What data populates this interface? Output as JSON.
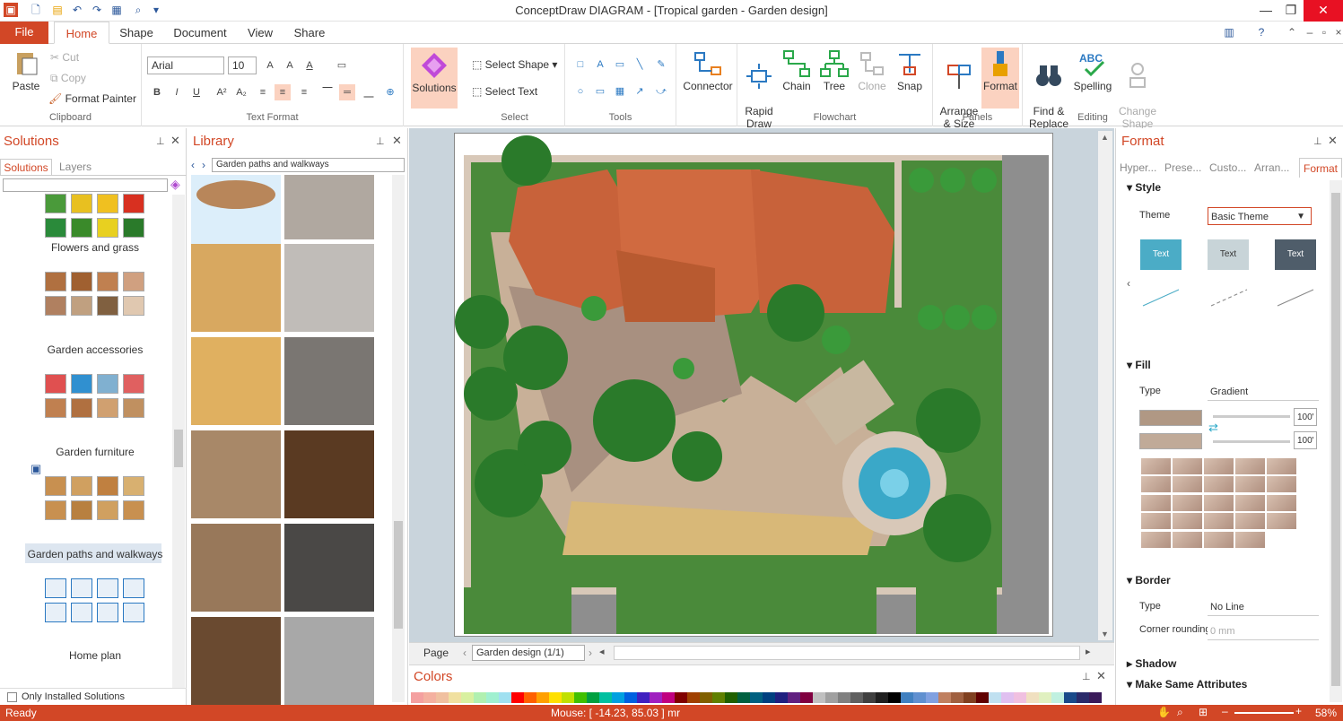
{
  "app": {
    "title": "ConceptDraw DIAGRAM - [Tropical garden - Garden design]"
  },
  "tabs": {
    "file": "File",
    "home": "Home",
    "shape": "Shape",
    "document": "Document",
    "view": "View",
    "share": "Share"
  },
  "ribbon": {
    "clipboard": {
      "paste": "Paste",
      "cut": "Cut",
      "copy": "Copy",
      "format_painter": "Format Painter",
      "group": "Clipboard"
    },
    "text_format": {
      "font": "Arial",
      "size": "10",
      "group": "Text Format"
    },
    "solutions_btn": "Solutions",
    "select": {
      "select_shape": "Select Shape",
      "select_text": "Select Text",
      "group": "Select"
    },
    "tools_group": "Tools",
    "connector": "Connector",
    "flowchart": {
      "rapid_draw": "Rapid\nDraw",
      "chain": "Chain",
      "tree": "Tree",
      "clone": "Clone",
      "snap": "Snap",
      "group": "Flowchart"
    },
    "panels": {
      "arrange_size": "Arrange\n& Size",
      "format": "Format",
      "group": "Panels"
    },
    "editing": {
      "find_replace": "Find &\nReplace",
      "spelling": "Spelling",
      "change_shape": "Change\nShape",
      "group": "Editing"
    }
  },
  "solutions_panel": {
    "title": "Solutions",
    "tab_solutions": "Solutions",
    "tab_layers": "Layers",
    "search_placeholder": "",
    "items": [
      "Flowers and grass",
      "Garden accessories",
      "Garden furniture",
      "Garden paths and walkways",
      "Home plan"
    ],
    "only_installed": "Only Installed Solutions"
  },
  "library_panel": {
    "title": "Library",
    "current": "Garden paths and walkways"
  },
  "format_panel": {
    "title": "Format",
    "tabs": [
      "Hyper...",
      "Prese...",
      "Custo...",
      "Arran...",
      "Format"
    ],
    "style": {
      "header": "Style",
      "theme_label": "Theme",
      "theme_value": "Basic Theme",
      "swatches": [
        "Text",
        "Text",
        "Text"
      ]
    },
    "fill": {
      "header": "Fill",
      "type_label": "Type",
      "type_value": "Gradient",
      "pct1": "100'",
      "pct2": "100'"
    },
    "border": {
      "header": "Border",
      "type_label": "Type",
      "type_value": "No Line",
      "corner_label": "Corner rounding",
      "corner_value": "0 mm"
    },
    "shadow": "Shadow",
    "make_same": "Make Same Attributes"
  },
  "pagebar": {
    "page_label": "Page",
    "page_value": "Garden design (1/1)"
  },
  "colors_panel": {
    "title": "Colors"
  },
  "status": {
    "left": "Ready",
    "mouse": "Mouse: [ -14.23, 85.03 ] mr",
    "zoom": "58%"
  },
  "colors": {
    "accent": "#d24726",
    "roof": "#c8623a",
    "lawn": "#4a8a3a",
    "road": "#8e8e8e",
    "water": "#3aa8c8"
  }
}
